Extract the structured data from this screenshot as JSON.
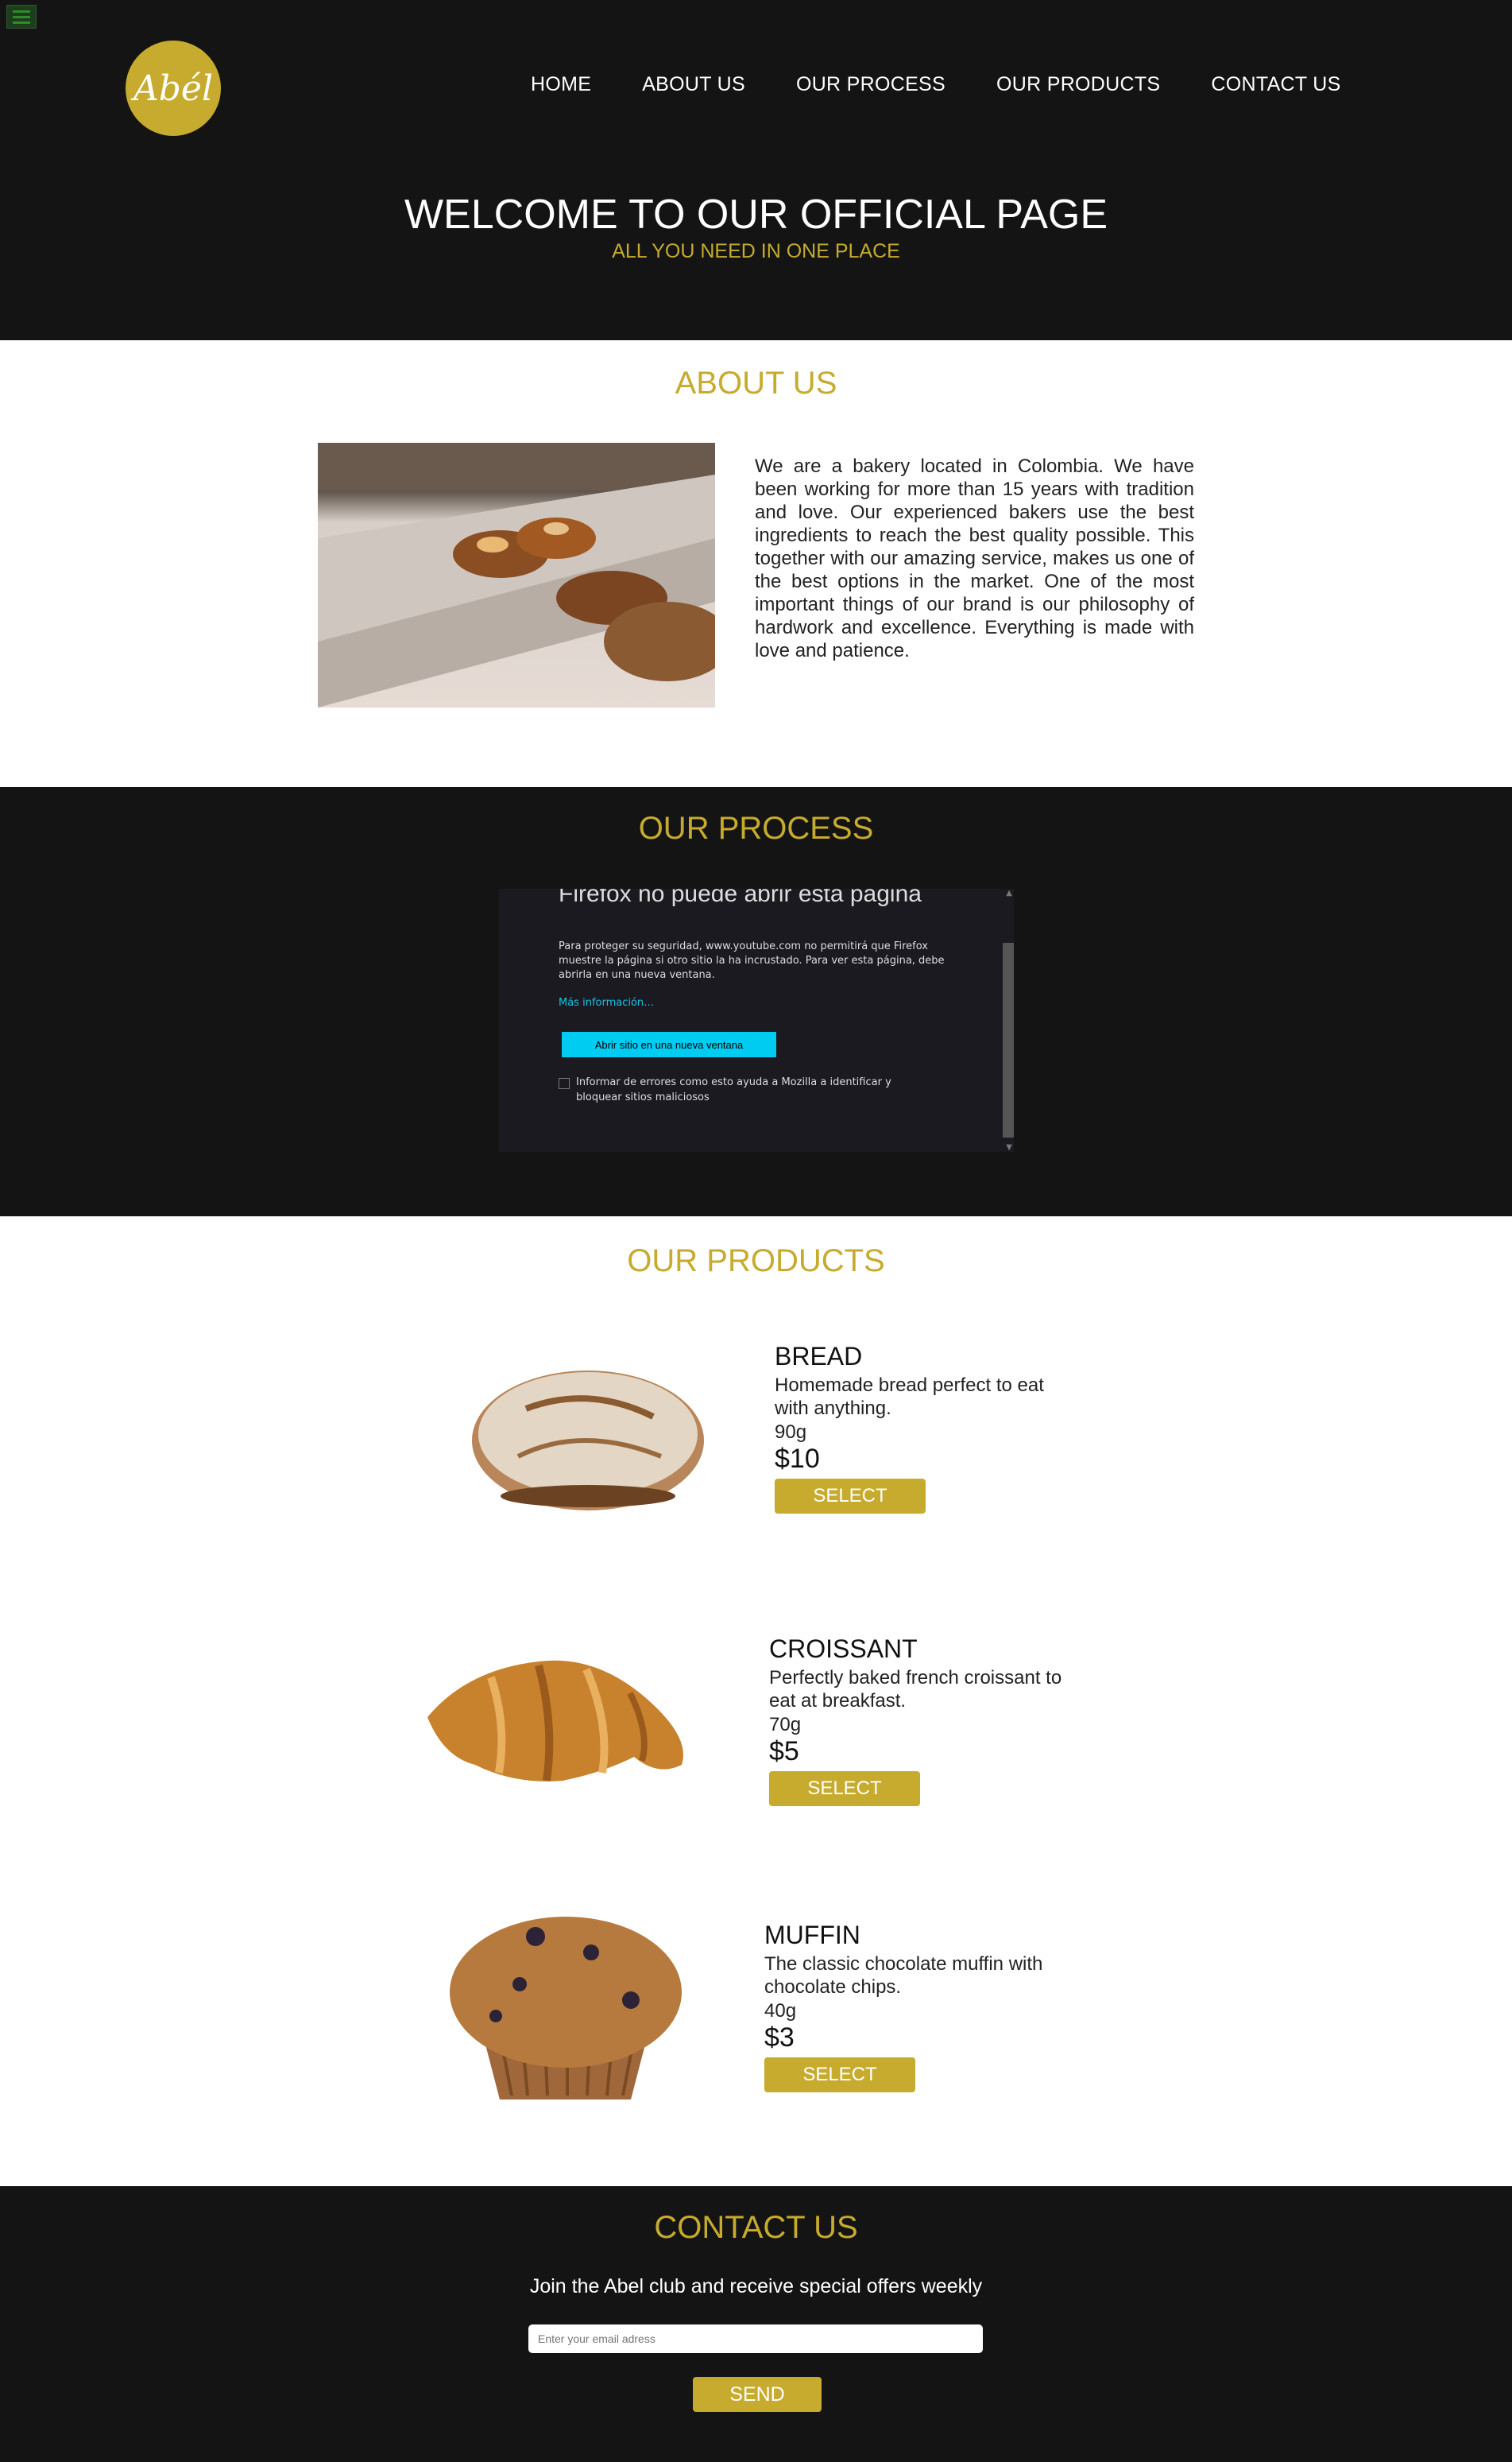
{
  "header": {
    "logo_text": "Abél",
    "nav": [
      "HOME",
      "ABOUT US",
      "OUR PROCESS",
      "OUR PRODUCTS",
      "CONTACT US"
    ],
    "welcome_title": "WELCOME TO OUR OFFICIAL PAGE",
    "welcome_subtitle": "ALL YOU NEED IN ONE PLACE"
  },
  "about": {
    "title": "ABOUT US",
    "text": "We are a bakery located in Colombia. We have been working for more than 15 years with tradition and love. Our experienced bakers use the best ingredients to reach the best quality possible. This together with our amazing service, makes us one of the best options in the market. One of the most important things of our brand is our philosophy of hardwork and excellence. Everything is made with love and patience."
  },
  "process": {
    "title": "OUR PROCESS",
    "frame": {
      "title": "Firefox no puede abrir esta página",
      "description": "Para proteger su seguridad, www.youtube.com no permitirá que Firefox muestre la página si otro sitio la ha incrustado. Para ver esta página, debe abrirla en una nueva ventana.",
      "link": "Más información…",
      "button": "Abrir sitio en una nueva ventana",
      "report": "Informar de errores como esto ayuda a Mozilla a identificar y bloquear sitios maliciosos"
    }
  },
  "products": {
    "title": "OUR PRODUCTS",
    "items": [
      {
        "name": "BREAD",
        "description": "Homemade bread perfect to eat with anything.",
        "weight": "90g",
        "price": "$10",
        "button": "SELECT"
      },
      {
        "name": "CROISSANT",
        "description": "Perfectly baked french croissant to eat at breakfast.",
        "weight": "70g",
        "price": "$5",
        "button": "SELECT"
      },
      {
        "name": "MUFFIN",
        "description": "The classic chocolate muffin with chocolate chips.",
        "weight": "40g",
        "price": "$3",
        "button": "SELECT"
      }
    ]
  },
  "contact": {
    "title": "CONTACT US",
    "text": "Join the Abel club and receive special offers weekly",
    "email_placeholder": "Enter your email adress",
    "send": "SEND"
  },
  "colors": {
    "accent": "#c6ab2e",
    "dark": "#141414",
    "iframe_button": "#00cbf0"
  }
}
